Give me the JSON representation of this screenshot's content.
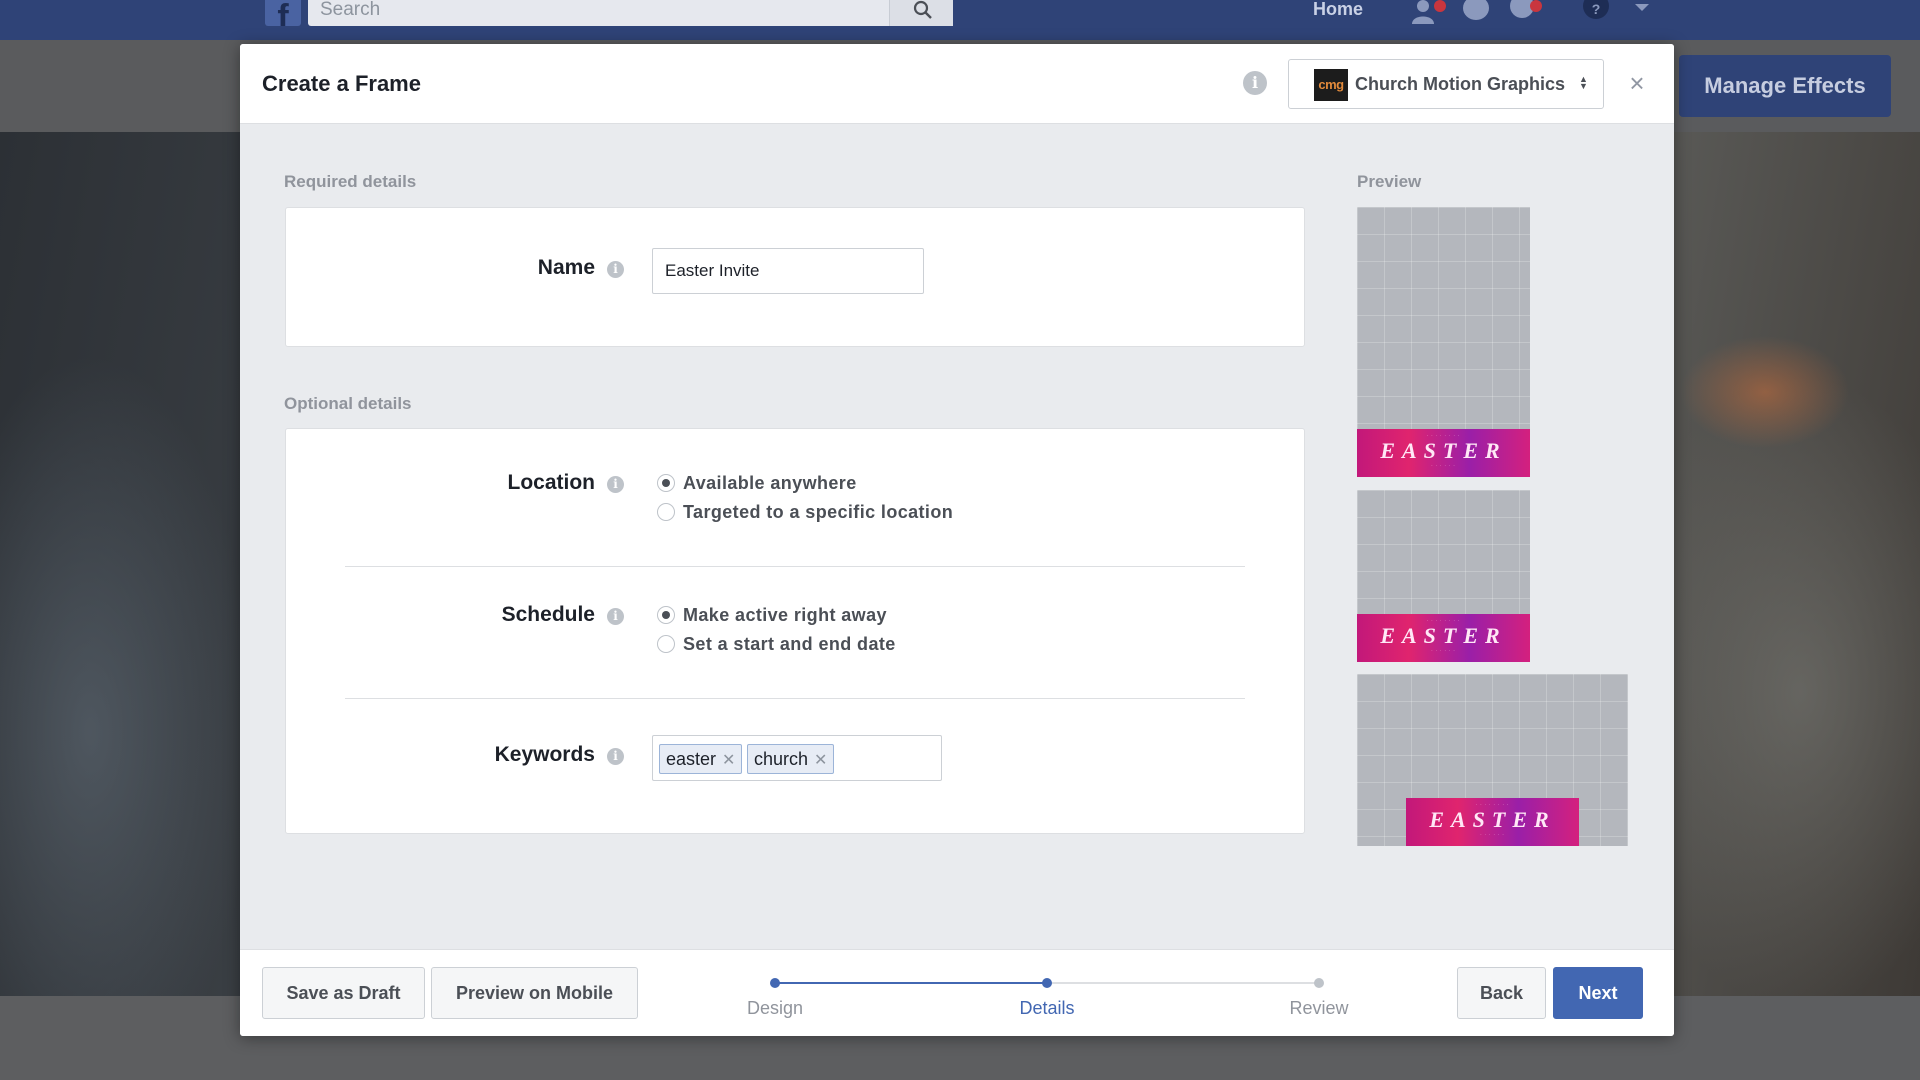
{
  "topbar": {
    "logo_letter": "f",
    "search_placeholder": "Search",
    "home_label": "Home"
  },
  "page": {
    "manage_effects_label": "Manage Effects"
  },
  "modal": {
    "title": "Create a Frame",
    "page_selector": {
      "logo_text": "cmg",
      "selected_page": "Church Motion Graphics"
    },
    "required_section": {
      "label": "Required details",
      "name": {
        "label": "Name",
        "value": "Easter Invite"
      }
    },
    "optional_section": {
      "label": "Optional details",
      "location": {
        "label": "Location",
        "options": [
          {
            "label": "Available anywhere",
            "selected": true
          },
          {
            "label": "Targeted to a specific location",
            "selected": false
          }
        ]
      },
      "schedule": {
        "label": "Schedule",
        "options": [
          {
            "label": "Make active right away",
            "selected": true
          },
          {
            "label": "Set a start and end date",
            "selected": false
          }
        ]
      },
      "keywords": {
        "label": "Keywords",
        "tags": [
          "easter",
          "church"
        ]
      }
    },
    "preview": {
      "label": "Preview",
      "frame_word": "EASTER"
    },
    "footer": {
      "save_draft_label": "Save as Draft",
      "preview_mobile_label": "Preview on Mobile",
      "steps": [
        {
          "label": "Design",
          "state": "done"
        },
        {
          "label": "Details",
          "state": "current"
        },
        {
          "label": "Review",
          "state": "upcoming"
        }
      ],
      "back_label": "Back",
      "next_label": "Next"
    }
  },
  "colors": {
    "facebook_blue": "#4267b2",
    "topbar": "#2f4377",
    "muted_text": "#90949c"
  }
}
